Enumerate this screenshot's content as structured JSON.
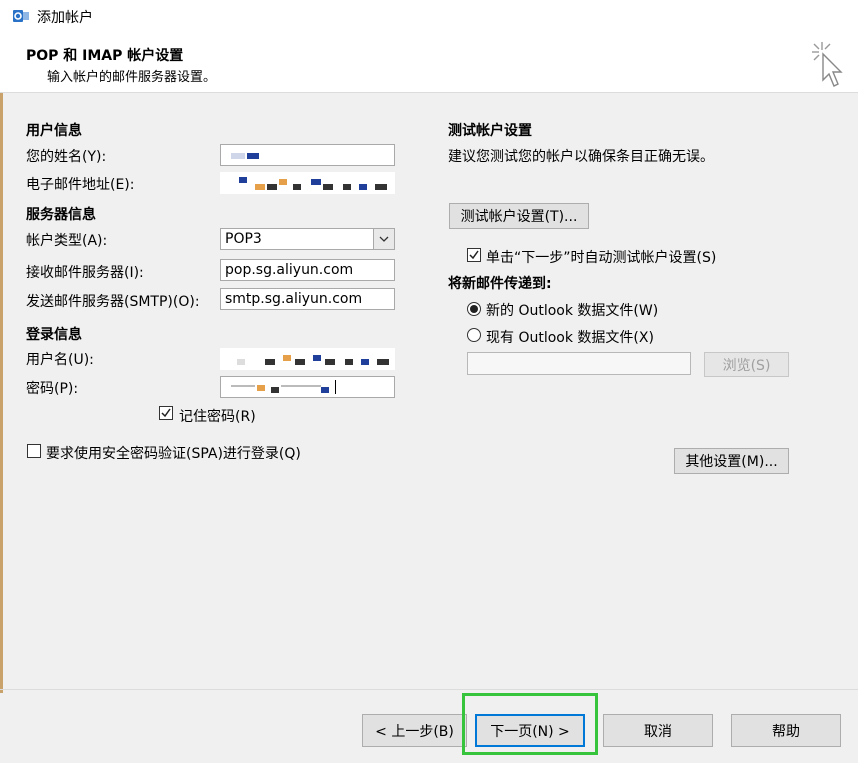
{
  "window": {
    "title": "添加帐户"
  },
  "header": {
    "title": "POP 和 IMAP 帐户设置",
    "subtitle": "输入帐户的邮件服务器设置。"
  },
  "user_info": {
    "section": "用户信息",
    "name_label": "您的姓名(Y):",
    "email_label": "电子邮件地址(E):"
  },
  "server_info": {
    "section": "服务器信息",
    "account_type_label": "帐户类型(A):",
    "account_type_value": "POP3",
    "incoming_label": "接收邮件服务器(I):",
    "incoming_value": "pop.sg.aliyun.com",
    "outgoing_label": "发送邮件服务器(SMTP)(O):",
    "outgoing_value": "smtp.sg.aliyun.com"
  },
  "login_info": {
    "section": "登录信息",
    "username_label": "用户名(U):",
    "password_label": "密码(P):",
    "remember_label": "记住密码(R)",
    "remember_checked": true
  },
  "spa": {
    "label": "要求使用安全密码验证(SPA)进行登录(Q)",
    "checked": false
  },
  "test_settings": {
    "section": "测试帐户设置",
    "description": "建议您测试您的帐户以确保条目正确无误。",
    "test_button": "测试帐户设置(T)...",
    "auto_test_label": "单击“下一步”时自动测试帐户设置(S)",
    "auto_test_checked": true
  },
  "deliver": {
    "section": "将新邮件传递到:",
    "new_file_label": "新的 Outlook 数据文件(W)",
    "existing_file_label": "现有 Outlook 数据文件(X)",
    "selected": "new",
    "browse_button": "浏览(S)"
  },
  "more_settings_button": "其他设置(M)...",
  "footer": {
    "back_button": "< 上一步(B)",
    "next_button": "下一页(N) >",
    "cancel_button": "取消",
    "help_button": "帮助"
  },
  "colors": {
    "highlight": "#35c43b",
    "accent_blot": "#1f3f9a",
    "warm_blot": "#e6a04a"
  }
}
